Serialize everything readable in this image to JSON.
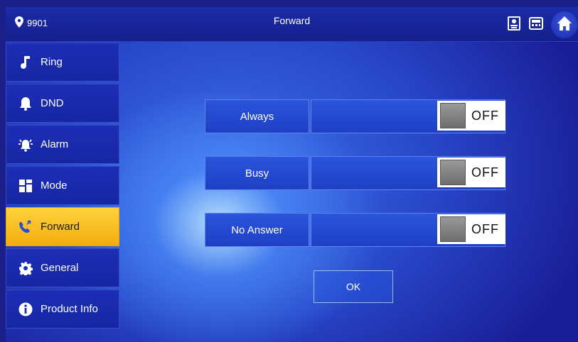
{
  "header": {
    "location_id": "9901",
    "title": "Forward"
  },
  "sidebar": {
    "items": [
      {
        "label": "Ring",
        "icon": "music-note-icon"
      },
      {
        "label": "DND",
        "icon": "bell-icon"
      },
      {
        "label": "Alarm",
        "icon": "alarm-icon"
      },
      {
        "label": "Mode",
        "icon": "grid-icon"
      },
      {
        "label": "Forward",
        "icon": "forward-call-icon",
        "active": true
      },
      {
        "label": "General",
        "icon": "gear-icon"
      },
      {
        "label": "Product Info",
        "icon": "info-icon"
      }
    ]
  },
  "forward": {
    "rows": [
      {
        "label": "Always",
        "value": "",
        "toggle": "OFF"
      },
      {
        "label": "Busy",
        "value": "",
        "toggle": "OFF"
      },
      {
        "label": "No Answer",
        "value": "",
        "toggle": "OFF"
      }
    ],
    "ok_label": "OK"
  },
  "colors": {
    "active_tab": "#f5b715",
    "panel": "#1c2eb6",
    "background": "#2746c9"
  }
}
